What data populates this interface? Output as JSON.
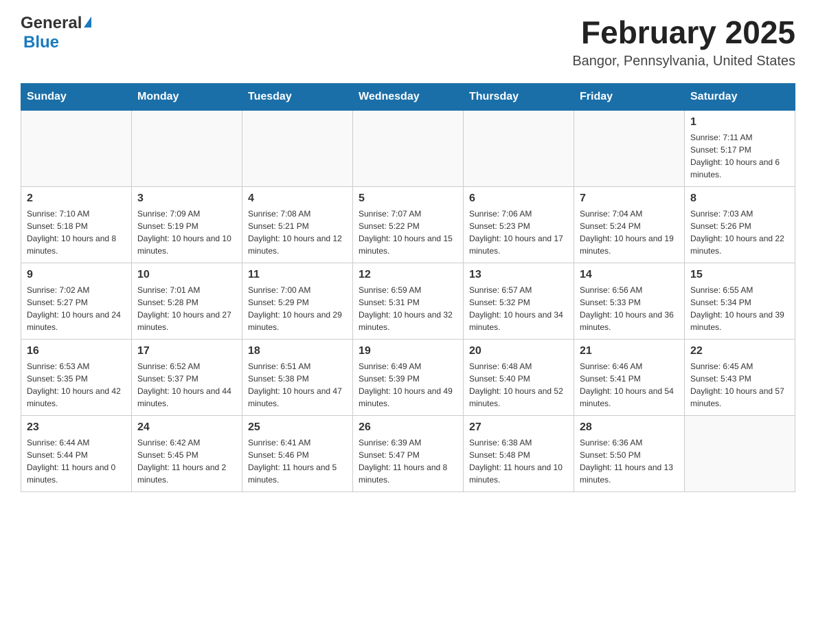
{
  "header": {
    "logo_general": "General",
    "logo_blue": "Blue",
    "calendar_title": "February 2025",
    "calendar_subtitle": "Bangor, Pennsylvania, United States"
  },
  "weekdays": [
    "Sunday",
    "Monday",
    "Tuesday",
    "Wednesday",
    "Thursday",
    "Friday",
    "Saturday"
  ],
  "weeks": [
    {
      "days": [
        {
          "num": "",
          "info": ""
        },
        {
          "num": "",
          "info": ""
        },
        {
          "num": "",
          "info": ""
        },
        {
          "num": "",
          "info": ""
        },
        {
          "num": "",
          "info": ""
        },
        {
          "num": "",
          "info": ""
        },
        {
          "num": "1",
          "info": "Sunrise: 7:11 AM\nSunset: 5:17 PM\nDaylight: 10 hours and 6 minutes."
        }
      ]
    },
    {
      "days": [
        {
          "num": "2",
          "info": "Sunrise: 7:10 AM\nSunset: 5:18 PM\nDaylight: 10 hours and 8 minutes."
        },
        {
          "num": "3",
          "info": "Sunrise: 7:09 AM\nSunset: 5:19 PM\nDaylight: 10 hours and 10 minutes."
        },
        {
          "num": "4",
          "info": "Sunrise: 7:08 AM\nSunset: 5:21 PM\nDaylight: 10 hours and 12 minutes."
        },
        {
          "num": "5",
          "info": "Sunrise: 7:07 AM\nSunset: 5:22 PM\nDaylight: 10 hours and 15 minutes."
        },
        {
          "num": "6",
          "info": "Sunrise: 7:06 AM\nSunset: 5:23 PM\nDaylight: 10 hours and 17 minutes."
        },
        {
          "num": "7",
          "info": "Sunrise: 7:04 AM\nSunset: 5:24 PM\nDaylight: 10 hours and 19 minutes."
        },
        {
          "num": "8",
          "info": "Sunrise: 7:03 AM\nSunset: 5:26 PM\nDaylight: 10 hours and 22 minutes."
        }
      ]
    },
    {
      "days": [
        {
          "num": "9",
          "info": "Sunrise: 7:02 AM\nSunset: 5:27 PM\nDaylight: 10 hours and 24 minutes."
        },
        {
          "num": "10",
          "info": "Sunrise: 7:01 AM\nSunset: 5:28 PM\nDaylight: 10 hours and 27 minutes."
        },
        {
          "num": "11",
          "info": "Sunrise: 7:00 AM\nSunset: 5:29 PM\nDaylight: 10 hours and 29 minutes."
        },
        {
          "num": "12",
          "info": "Sunrise: 6:59 AM\nSunset: 5:31 PM\nDaylight: 10 hours and 32 minutes."
        },
        {
          "num": "13",
          "info": "Sunrise: 6:57 AM\nSunset: 5:32 PM\nDaylight: 10 hours and 34 minutes."
        },
        {
          "num": "14",
          "info": "Sunrise: 6:56 AM\nSunset: 5:33 PM\nDaylight: 10 hours and 36 minutes."
        },
        {
          "num": "15",
          "info": "Sunrise: 6:55 AM\nSunset: 5:34 PM\nDaylight: 10 hours and 39 minutes."
        }
      ]
    },
    {
      "days": [
        {
          "num": "16",
          "info": "Sunrise: 6:53 AM\nSunset: 5:35 PM\nDaylight: 10 hours and 42 minutes."
        },
        {
          "num": "17",
          "info": "Sunrise: 6:52 AM\nSunset: 5:37 PM\nDaylight: 10 hours and 44 minutes."
        },
        {
          "num": "18",
          "info": "Sunrise: 6:51 AM\nSunset: 5:38 PM\nDaylight: 10 hours and 47 minutes."
        },
        {
          "num": "19",
          "info": "Sunrise: 6:49 AM\nSunset: 5:39 PM\nDaylight: 10 hours and 49 minutes."
        },
        {
          "num": "20",
          "info": "Sunrise: 6:48 AM\nSunset: 5:40 PM\nDaylight: 10 hours and 52 minutes."
        },
        {
          "num": "21",
          "info": "Sunrise: 6:46 AM\nSunset: 5:41 PM\nDaylight: 10 hours and 54 minutes."
        },
        {
          "num": "22",
          "info": "Sunrise: 6:45 AM\nSunset: 5:43 PM\nDaylight: 10 hours and 57 minutes."
        }
      ]
    },
    {
      "days": [
        {
          "num": "23",
          "info": "Sunrise: 6:44 AM\nSunset: 5:44 PM\nDaylight: 11 hours and 0 minutes."
        },
        {
          "num": "24",
          "info": "Sunrise: 6:42 AM\nSunset: 5:45 PM\nDaylight: 11 hours and 2 minutes."
        },
        {
          "num": "25",
          "info": "Sunrise: 6:41 AM\nSunset: 5:46 PM\nDaylight: 11 hours and 5 minutes."
        },
        {
          "num": "26",
          "info": "Sunrise: 6:39 AM\nSunset: 5:47 PM\nDaylight: 11 hours and 8 minutes."
        },
        {
          "num": "27",
          "info": "Sunrise: 6:38 AM\nSunset: 5:48 PM\nDaylight: 11 hours and 10 minutes."
        },
        {
          "num": "28",
          "info": "Sunrise: 6:36 AM\nSunset: 5:50 PM\nDaylight: 11 hours and 13 minutes."
        },
        {
          "num": "",
          "info": ""
        }
      ]
    }
  ]
}
